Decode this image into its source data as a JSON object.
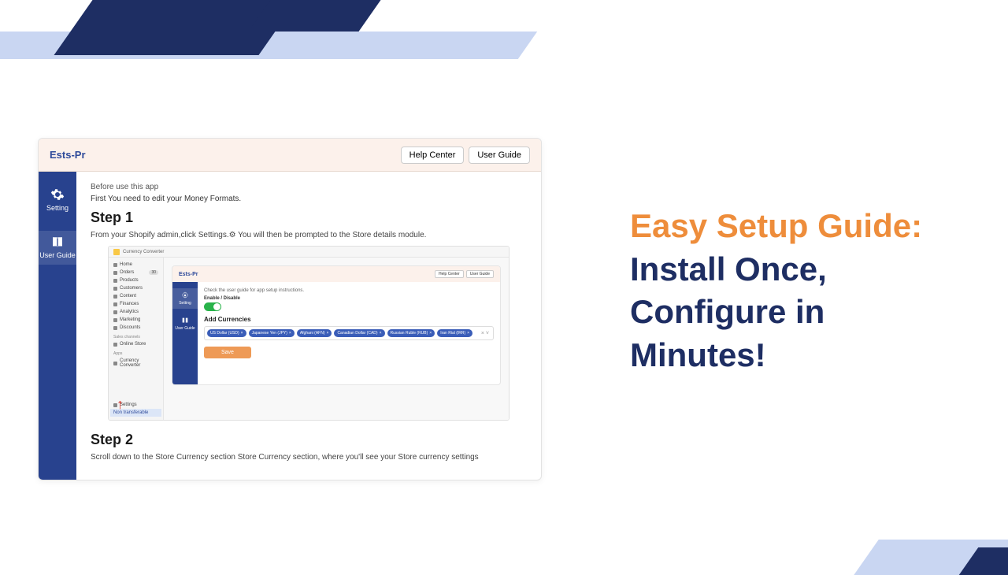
{
  "marketing": {
    "title_orange": "Easy Setup Guide:",
    "title_rest": "Install Once, Configure in Minutes!"
  },
  "app": {
    "brand": "Ests-Pr",
    "header_buttons": {
      "help": "Help Center",
      "guide": "User Guide"
    },
    "sidebar": {
      "setting": "Setting",
      "user_guide": "User Guide"
    },
    "content": {
      "notice": "Before use this app",
      "lead": "First You need to edit your Money Formats.",
      "step1_title": "Step 1",
      "step1_desc": "From your Shopify admin,click Settings.⚙ You will then be prompted to the Store details module.",
      "step2_title": "Step 2",
      "step2_desc": "Scroll down to the Store Currency section Store Currency section, where you'll see your Store currency settings"
    }
  },
  "inner": {
    "top_title": "Currency Converter",
    "sidebar_items": [
      "Home",
      "Orders",
      "Products",
      "Customers",
      "Content",
      "Finances",
      "Analytics",
      "Marketing",
      "Discounts"
    ],
    "sales_channels_label": "Sales channels",
    "online_store": "Online Store",
    "apps_label": "Apps",
    "currency_converter": "Currency Converter",
    "settings": "Settings",
    "non_transferable": "Non transferable",
    "card": {
      "brand": "Ests-Pr",
      "btns": {
        "help": "Help Center",
        "guide": "User Guide"
      },
      "sb": {
        "setting": "Setting",
        "user_guide": "User Guide"
      },
      "hint": "Check the user guide for app setup instructions.",
      "enable_label": "Enable / Disable",
      "add_title": "Add Currencies",
      "chips": [
        "US Dollar (USD)",
        "Japanese Yen (JPY)",
        "Afghani (AFN)",
        "Canadian Dollar (CAD)",
        "Russian Ruble (RUB)",
        "Iran Rial (IRR)"
      ],
      "save": "Save"
    }
  }
}
